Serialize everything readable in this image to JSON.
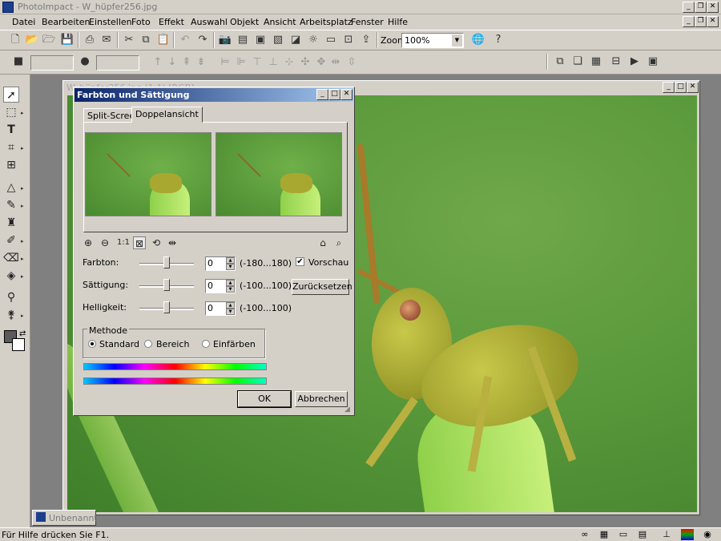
{
  "app": {
    "title": "PhotoImpact - W_hüpfer256.jpg"
  },
  "menu": [
    "Datei",
    "Bearbeiten",
    "Einstellen",
    "Foto",
    "Effekt",
    "Auswahl",
    "Objekt",
    "Ansicht",
    "Arbeitsplatz",
    "Fenster",
    "Hilfe"
  ],
  "toolbar": {
    "zoom_label": "Zoom",
    "zoom_value": "100%"
  },
  "document": {
    "title": "W_hüpfer256.jpg (1:1) [RGB]",
    "minimized_title": "Unbenannt"
  },
  "dialog": {
    "title": "Farbton und Sättigung",
    "tabs": [
      "Split-Screen",
      "Doppelansicht"
    ],
    "active_tab": "Doppelansicht",
    "preview_zoom_label": "1:1",
    "fields": [
      {
        "label": "Farbton:",
        "value": "0",
        "range": "(-180...180)"
      },
      {
        "label": "Sättigung:",
        "value": "0",
        "range": "(-100...100)"
      },
      {
        "label": "Helligkeit:",
        "value": "0",
        "range": "(-100...100)"
      }
    ],
    "preview_label": "Vorschau",
    "preview_checked": true,
    "reset_label": "Zurücksetzen",
    "method": {
      "title": "Methode",
      "options": [
        "Standard",
        "Bereich",
        "Einfärben"
      ],
      "selected": "Standard"
    },
    "ok_label": "OK",
    "cancel_label": "Abbrechen"
  },
  "status": {
    "text": "Für Hilfe drücken Sie F1."
  }
}
